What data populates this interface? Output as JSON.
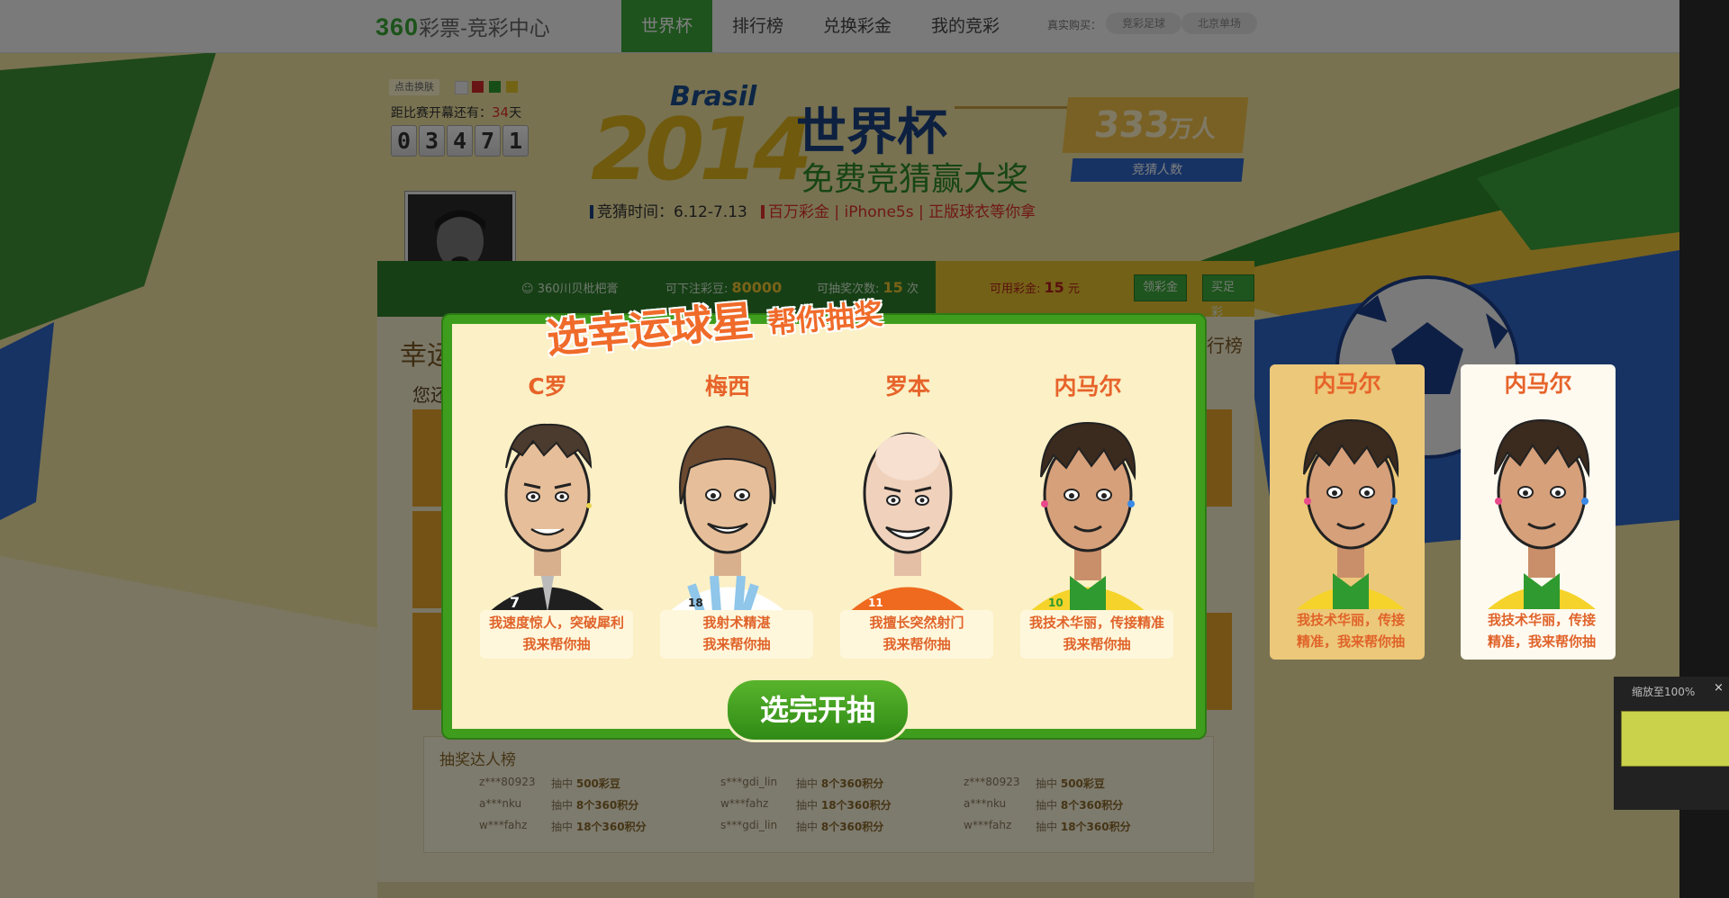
{
  "topbar": {
    "logo_main": "360",
    "logo_sub": "彩票-竞彩中心",
    "nav": [
      {
        "label": "世界杯",
        "active": true
      },
      {
        "label": "排行榜"
      },
      {
        "label": "兑换彩金"
      },
      {
        "label": "我的竞彩"
      }
    ],
    "real_buy_label": "真实购买：",
    "pills": [
      "竞彩足球",
      "北京单场"
    ]
  },
  "sidebar_left": {
    "skin_label": "点击换肤",
    "skin_colors": [
      "#f0f0f0",
      "#d22a2a",
      "#2f9a2f",
      "#e6c82a"
    ],
    "countdown_prefix": "距比赛开幕还有：",
    "countdown_days": "34",
    "countdown_suffix": "天",
    "digits": [
      "0",
      "3",
      "4",
      "7",
      "1"
    ]
  },
  "hero": {
    "brasil": "Brasil",
    "year": "2014",
    "title": "世界杯",
    "subtitle": "免费竞猜赢大奖",
    "time_text": "竞猜时间：6.12-7.13",
    "prize_text": "百万彩金 | iPhone5s | 正版球衣等你拿",
    "count_num": "333",
    "count_unit": "万人",
    "count_label": "竞猜人数"
  },
  "info_bar": {
    "user": "360川贝枇杷膏",
    "bet_label": "可下注彩豆:",
    "bet_value": "80000",
    "draw_label": "可抽奖次数:",
    "draw_value": "15",
    "draw_unit": "次",
    "money_label": "可用彩金:",
    "money_value": "15",
    "money_unit": "元",
    "btn_claim": "领彩金",
    "btn_buy": "买足彩"
  },
  "content": {
    "title": "幸运",
    "right_link": "排行榜",
    "question": "您还"
  },
  "leaderboard": {
    "title": "抽奖达人榜",
    "rows": [
      [
        "z***80923",
        "抽中",
        "500彩豆",
        "s***gdi_lin",
        "抽中",
        "8个360积分",
        "z***80923",
        "抽中",
        "500彩豆"
      ],
      [
        "a***nku",
        "抽中",
        "8个360积分",
        "w***fahz",
        "抽中",
        "18个360积分",
        "a***nku",
        "抽中",
        "8个360积分"
      ],
      [
        "w***fahz",
        "抽中",
        "18个360积分",
        "s***gdi_lin",
        "抽中",
        "8个360积分",
        "w***fahz",
        "抽中",
        "18个360积分"
      ]
    ]
  },
  "modal": {
    "title_big": "选幸运球星",
    "title_small": "帮你抽奖",
    "players": [
      {
        "name": "C罗",
        "quote1": "我速度惊人，突破犀利",
        "quote2": "我来帮你抽",
        "jersey": "#1f1f1f",
        "num": "7"
      },
      {
        "name": "梅西",
        "quote1": "我射术精湛",
        "quote2": "我来帮你抽",
        "jersey": "#8fc6ea",
        "num": "18"
      },
      {
        "name": "罗本",
        "quote1": "我擅长突然射门",
        "quote2": "我来帮你抽",
        "jersey": "#ef6a1e",
        "num": "11"
      },
      {
        "name": "内马尔",
        "quote1": "我技术华丽，传接精准",
        "quote2": "我来帮你抽",
        "jersey": "#f5d32a",
        "num": "10"
      }
    ],
    "go_button": "选完开抽"
  },
  "extra_cards": [
    {
      "name": "内马尔",
      "quote1": "我技术华丽，传接",
      "quote2": "精准，我来帮你抽",
      "selected": true
    },
    {
      "name": "内马尔",
      "quote1": "我技术华丽，传接",
      "quote2": "精准，我来帮你抽",
      "selected": false
    }
  ],
  "zoom": {
    "label": "缩放至100%",
    "close": "×"
  }
}
